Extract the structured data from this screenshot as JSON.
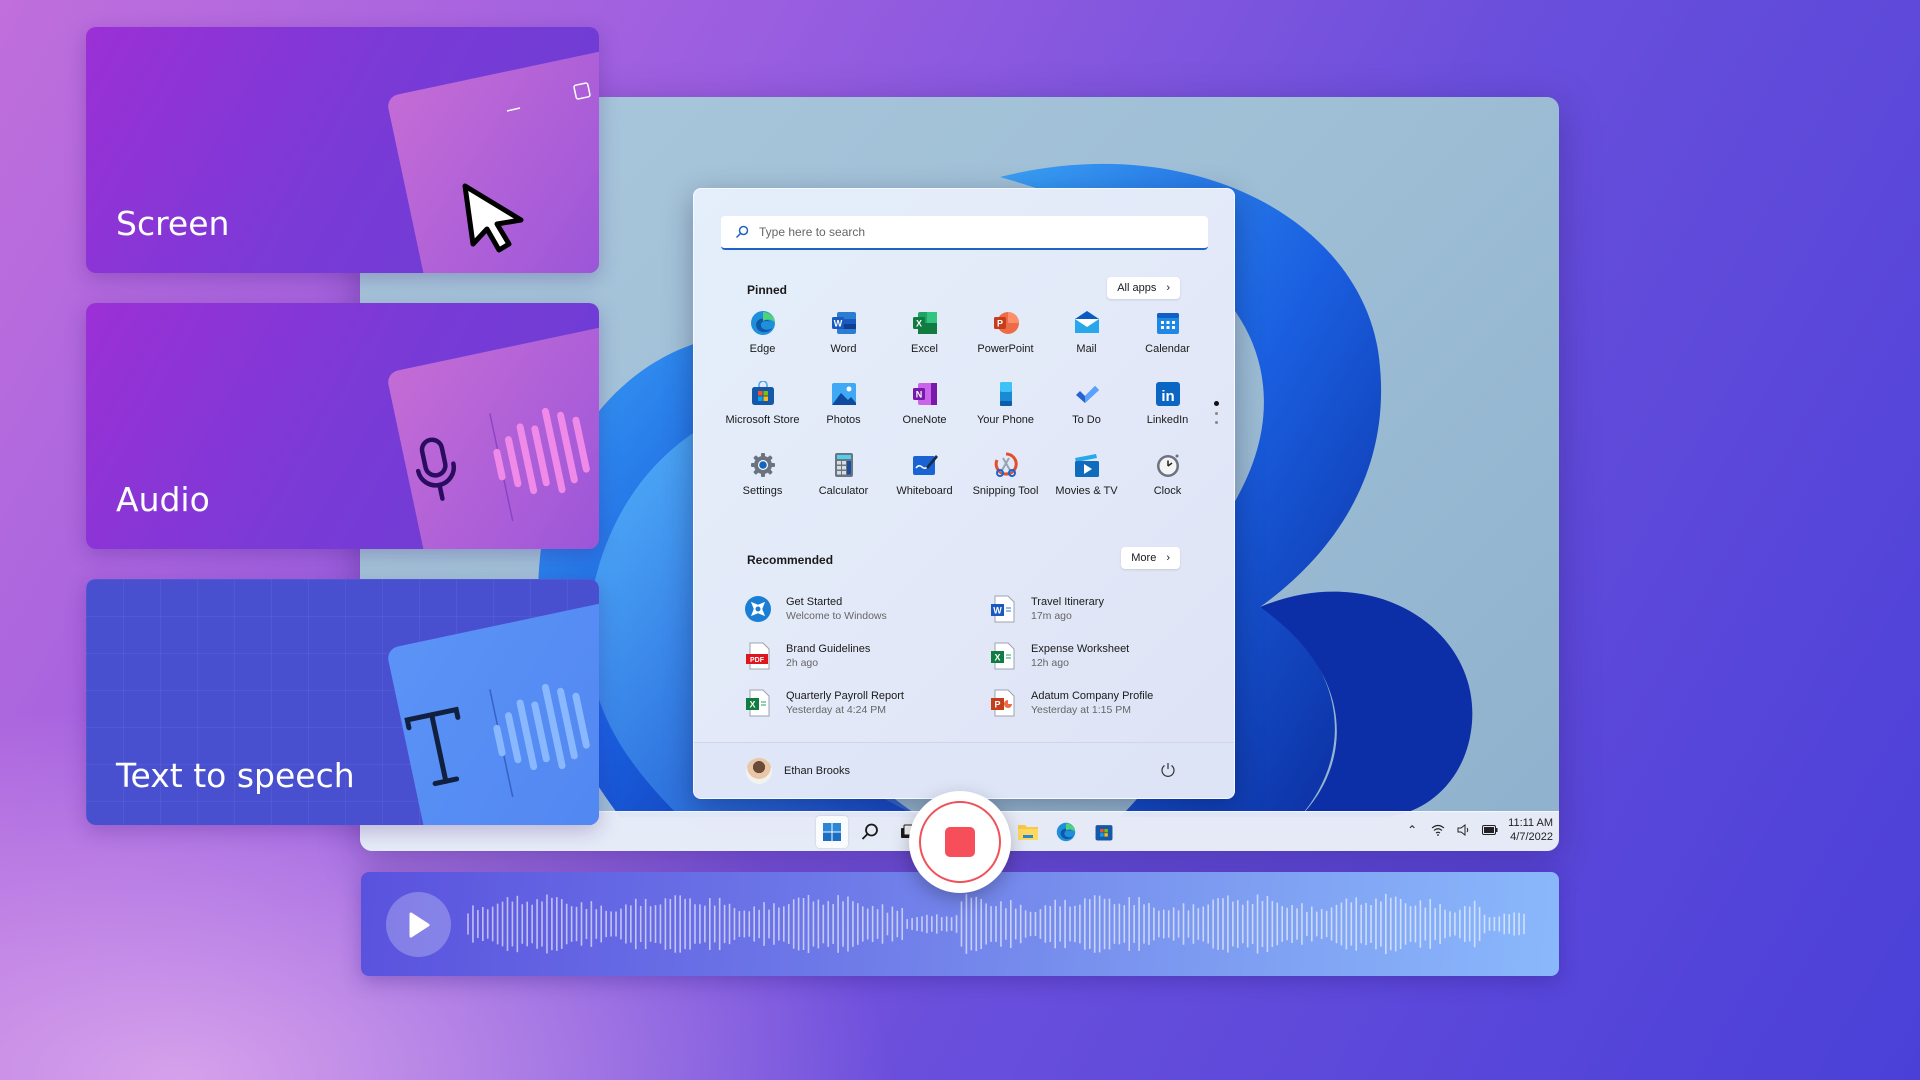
{
  "feature_cards": [
    {
      "id": "screen",
      "title": "Screen",
      "icon": "cursor-icon"
    },
    {
      "id": "audio",
      "title": "Audio",
      "icon": "microphone-icon"
    },
    {
      "id": "tts",
      "title": "Text to speech",
      "icon": "text-t-icon"
    }
  ],
  "start_menu": {
    "search_placeholder": "Type here to search",
    "pinned_title": "Pinned",
    "all_apps_label": "All apps",
    "pinned_apps": [
      {
        "label": "Edge",
        "icon": "edge-icon"
      },
      {
        "label": "Word",
        "icon": "word-icon"
      },
      {
        "label": "Excel",
        "icon": "excel-icon"
      },
      {
        "label": "PowerPoint",
        "icon": "powerpoint-icon"
      },
      {
        "label": "Mail",
        "icon": "mail-icon"
      },
      {
        "label": "Calendar",
        "icon": "calendar-icon"
      },
      {
        "label": "Microsoft Store",
        "icon": "store-icon"
      },
      {
        "label": "Photos",
        "icon": "photos-icon"
      },
      {
        "label": "OneNote",
        "icon": "onenote-icon"
      },
      {
        "label": "Your Phone",
        "icon": "phone-icon"
      },
      {
        "label": "To Do",
        "icon": "todo-icon"
      },
      {
        "label": "LinkedIn",
        "icon": "linkedin-icon"
      },
      {
        "label": "Settings",
        "icon": "settings-icon"
      },
      {
        "label": "Calculator",
        "icon": "calculator-icon"
      },
      {
        "label": "Whiteboard",
        "icon": "whiteboard-icon"
      },
      {
        "label": "Snipping Tool",
        "icon": "snipping-tool-icon"
      },
      {
        "label": "Movies & TV",
        "icon": "movies-icon"
      },
      {
        "label": "Clock",
        "icon": "clock-icon"
      }
    ],
    "pinned_page": {
      "current": 1,
      "total": 3
    },
    "recommended_title": "Recommended",
    "more_label": "More",
    "recommended": [
      {
        "title": "Get Started",
        "subtitle": "Welcome to Windows",
        "icon": "get-started-icon"
      },
      {
        "title": "Travel Itinerary",
        "subtitle": "17m ago",
        "icon": "word-doc-icon"
      },
      {
        "title": "Brand Guidelines",
        "subtitle": "2h ago",
        "icon": "pdf-icon"
      },
      {
        "title": "Expense Worksheet",
        "subtitle": "12h ago",
        "icon": "excel-doc-icon"
      },
      {
        "title": "Quarterly Payroll Report",
        "subtitle": "Yesterday at 4:24 PM",
        "icon": "excel-doc-icon"
      },
      {
        "title": "Adatum Company Profile",
        "subtitle": "Yesterday at 1:15 PM",
        "icon": "powerpoint-doc-icon"
      }
    ],
    "user_name": "Ethan Brooks"
  },
  "taskbar": {
    "time": "11:11 AM",
    "date": "4/7/2022"
  },
  "colors": {
    "accent": "#1f63c6",
    "record": "#f64e5a"
  }
}
